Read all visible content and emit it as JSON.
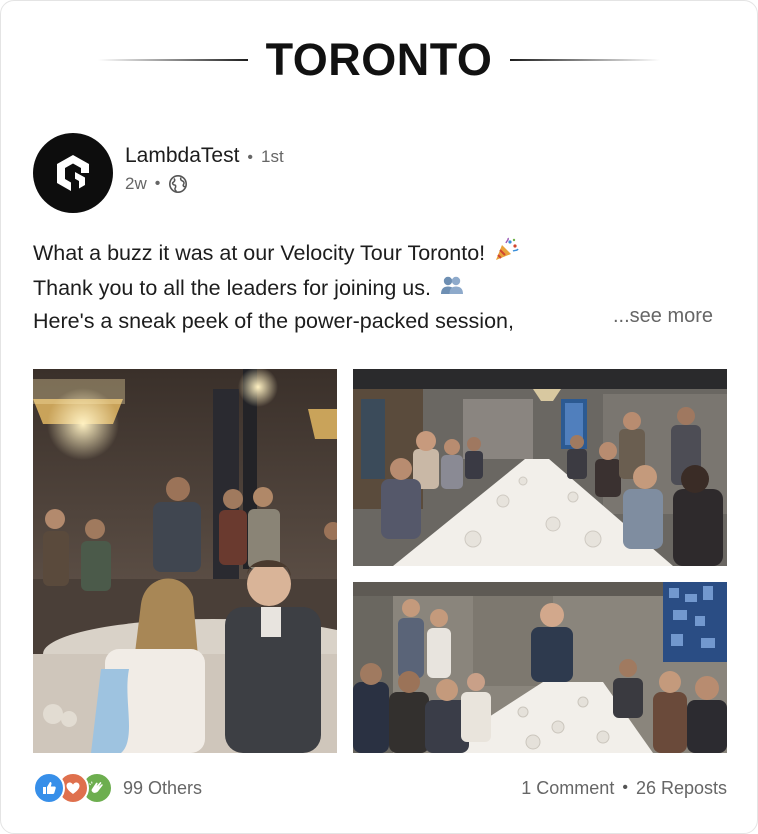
{
  "header": {
    "city": "TORONTO"
  },
  "author": {
    "name": "LambdaTest",
    "degree": "1st",
    "age": "2w",
    "avatar_icon": "lambdatest-logo-icon",
    "visibility_icon": "globe-icon"
  },
  "post": {
    "lines": [
      "What a buzz it was at our Velocity Tour Toronto!",
      "Thank you to all the leaders for joining us.",
      "Here's a sneak peek of the power-packed session,"
    ],
    "see_more": "...see more",
    "emojis": [
      "party-popper-icon",
      "people-icon"
    ]
  },
  "photos": [
    {
      "name": "event-photo-guests-mingling"
    },
    {
      "name": "event-photo-long-table"
    },
    {
      "name": "event-photo-speaker-at-table"
    }
  ],
  "footer": {
    "reaction_icons": [
      "like-icon",
      "love-icon",
      "clap-icon"
    ],
    "reactions_label": "99 Others",
    "comments_label": "1 Comment",
    "reposts_label": "26 Reposts"
  },
  "colors": {
    "like": "#378fe9",
    "love": "#df704d",
    "clap": "#6dae4f",
    "muted_text": "#666666"
  }
}
